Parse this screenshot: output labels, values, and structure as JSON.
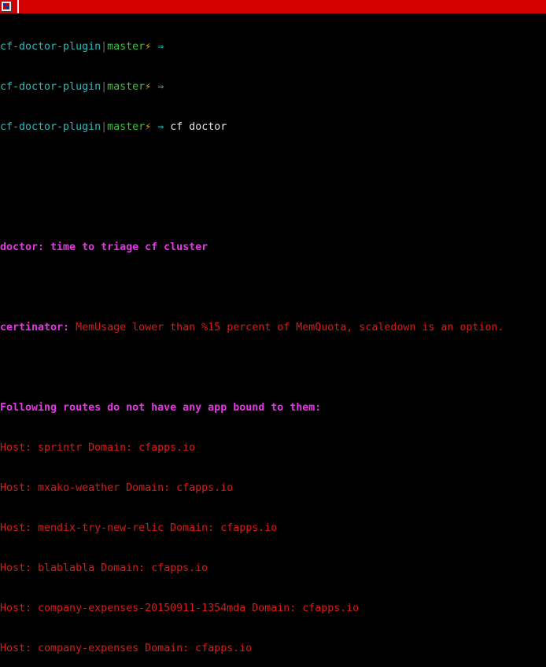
{
  "window": {
    "title": ""
  },
  "prompt": {
    "repo": "cf-doctor-plugin",
    "separator": "|",
    "branch": "master",
    "bolt": "⚡",
    "arrow": "⇒"
  },
  "history": [
    {
      "command": ""
    },
    {
      "command": ""
    },
    {
      "command": "cf doctor"
    }
  ],
  "output": {
    "doctor_heading": "doctor: time to triage cf cluster",
    "certinator_label": "certinator:",
    "certinator_message": " MemUsage lower than %15 percent of MemQuota, scaledown is an option.",
    "routes_heading": "Following routes do not have any app bound to them:",
    "routes": [
      "Host: sprintr Domain: cfapps.io",
      "Host: mxako-weather Domain: cfapps.io",
      "Host: mendix-try-new-relic Domain: cfapps.io",
      "Host: blablabla Domain: cfapps.io",
      "Host: company-expenses-20150911-1354mda Domain: cfapps.io",
      "Host: company-expenses Domain: cfapps.io"
    ]
  },
  "colors": {
    "titlebar": "#d40000",
    "repo": "#2fb8b8",
    "branch": "#3fbf3f",
    "heading": "#e535e5",
    "error": "#d41c1c"
  }
}
